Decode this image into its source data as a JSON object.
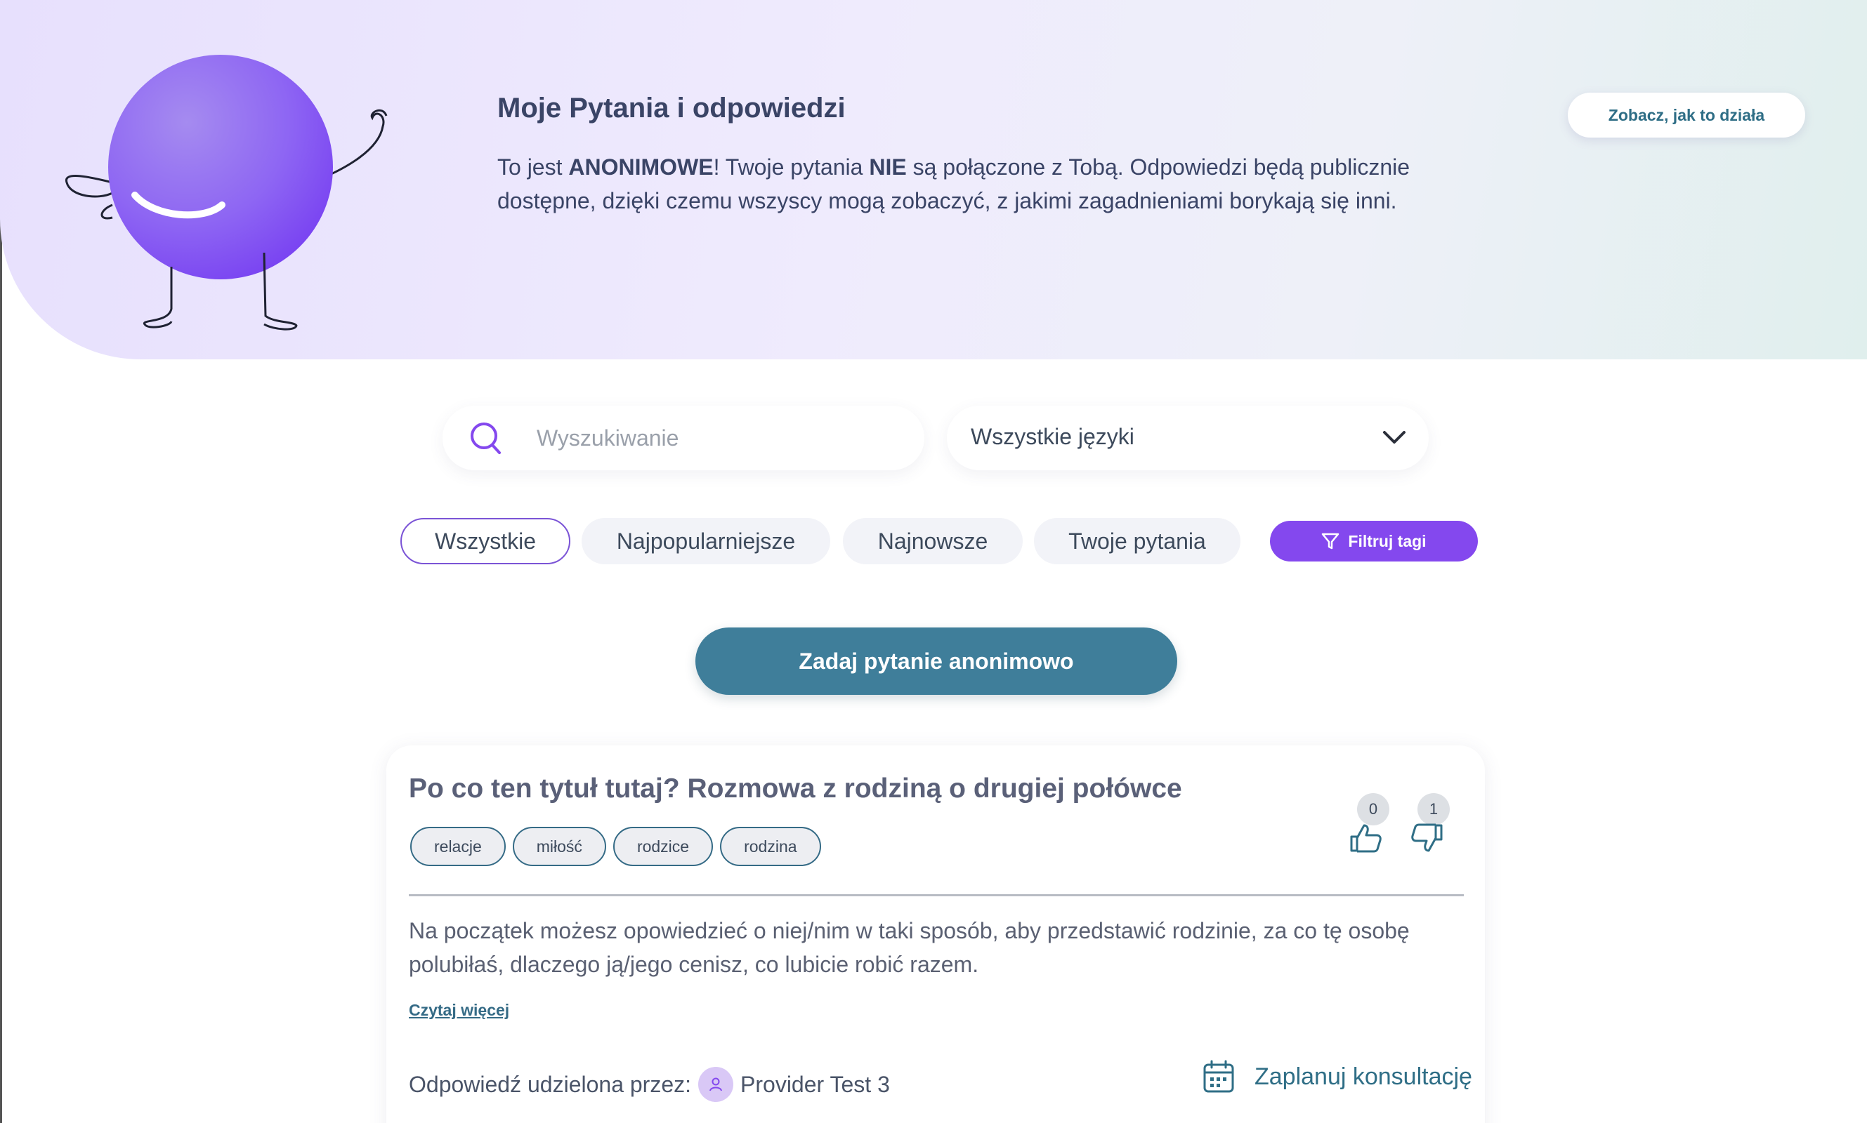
{
  "hero": {
    "title": "Moje Pytania i odpowiedzi",
    "text_pre": "To jest ",
    "text_bold1": "ANONIMOWE",
    "text_mid": "! Twoje pytania ",
    "text_bold2": "NIE",
    "text_post": " są połączone z Tobą. Odpowiedzi będą publicznie dostępne, dzięki czemu wszyscy mogą zobaczyć, z jakimi zagadnieniami borykają się inni.",
    "how_button": "Zobacz, jak to działa"
  },
  "search": {
    "placeholder": "Wyszukiwanie"
  },
  "language": {
    "selected": "Wszystkie języki"
  },
  "tabs": [
    {
      "label": "Wszystkie",
      "active": true
    },
    {
      "label": "Najpopularniejsze",
      "active": false
    },
    {
      "label": "Najnowsze",
      "active": false
    },
    {
      "label": "Twoje pytania",
      "active": false
    }
  ],
  "filter_button": "Filtruj tagi",
  "ask_button": "Zadaj pytanie anonimowo",
  "question": {
    "title": "Po co ten tytuł tutaj? Rozmowa z rodziną o drugiej połówce",
    "tags": [
      "relacje",
      "miłość",
      "rodzice",
      "rodzina"
    ],
    "likes": "0",
    "dislikes": "1",
    "answer": "Na początek możesz opowiedzieć o niej/nim w taki sposób, aby przedstawić rodzinie, za co tę osobę polubiłaś, dlaczego ją/jego cenisz, co lubicie robić razem.",
    "read_more": "Czytaj więcej",
    "answered_by_label": "Odpowiedź udzielona przez:",
    "provider": "Provider Test 3",
    "consult": "Zaplanuj konsultację"
  },
  "colors": {
    "accent_purple": "#8448ee",
    "primary_teal": "#3f7e9a",
    "link_teal": "#2f6e86"
  }
}
